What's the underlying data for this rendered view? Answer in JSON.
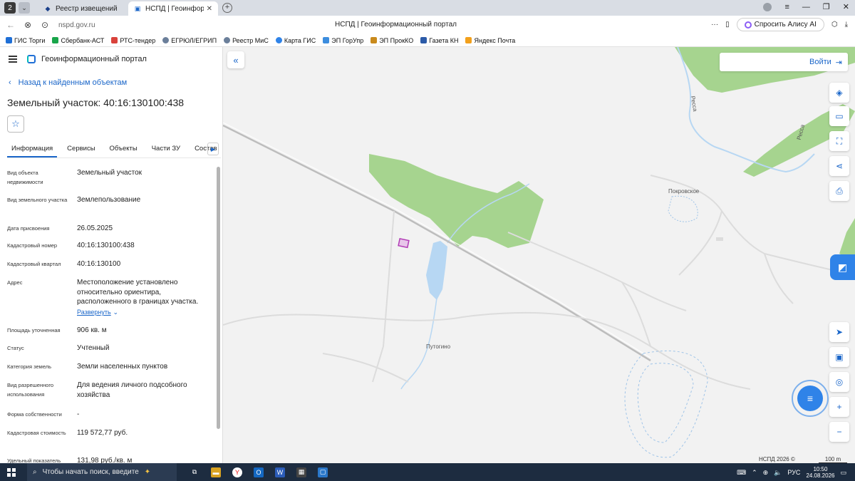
{
  "browser": {
    "tab_count": "2",
    "tabs": [
      {
        "title": "Реестр извещений",
        "active": false
      },
      {
        "title": "НСПД | Геоинформаци",
        "active": true
      }
    ],
    "url": "nspd.gov.ru",
    "page_title": "НСПД | Геоинформационный портал",
    "alisa": "Спросить Алису AI",
    "bookmarks": [
      "ГИС Торги",
      "Сбербанк-АСТ",
      "РТС-тендер",
      "ЕГРЮЛ/ЕГРИП",
      "Реестр МиС",
      "Карта ГИС",
      "ЭП ГорУпр",
      "ЭП ПрокКО",
      "Газета КН",
      "Яндекс Почта"
    ]
  },
  "panel": {
    "app_title": "Геоинформационный портал",
    "back_label": "Назад к найденным объектам",
    "object_title": "Земельный участок: 40:16:130100:438",
    "tabs": [
      "Информация",
      "Сервисы",
      "Объекты",
      "Части ЗУ",
      "Состав"
    ],
    "attributes": [
      {
        "key": "Вид объекта недвижимости",
        "value": "Земельный участок"
      },
      {
        "key": "Вид земельного участка",
        "value": "Землепользование"
      },
      {
        "key": "Дата присвоения",
        "value": "26.05.2025"
      },
      {
        "key": "Кадастровый номер",
        "value": "40:16:130100:438"
      },
      {
        "key": "Кадастровый квартал",
        "value": "40:16:130100"
      },
      {
        "key": "Адрес",
        "value": "Местоположение установлено относительно ориентира, расположенного в границах участка."
      },
      {
        "key": "Площадь уточненная",
        "value": "906 кв. м"
      },
      {
        "key": "Статус",
        "value": "Учтенный"
      },
      {
        "key": "Категория земель",
        "value": "Земли населенных пунктов"
      },
      {
        "key": "Вид разрешенного использования",
        "value": "Для ведения личного подсобного хозяйства"
      },
      {
        "key": "Форма собственности",
        "value": "-"
      },
      {
        "key": "Кадастровая стоимость",
        "value": "119 572,77 руб."
      },
      {
        "key": "Удельный показатель",
        "value": "131,98 руб./кв. м"
      }
    ],
    "expand_label": "Развернуть"
  },
  "map": {
    "login": "Войти",
    "labels": [
      "Покровское",
      "Путогино",
      "Ресса",
      "Ресса"
    ],
    "copyright": "НСПД 2026 ©",
    "scale": "100 m",
    "colors": {
      "forest": "#a6d48f",
      "water": "#b7d7f3",
      "parcel": "#b13bb5",
      "accent": "#1a66c9"
    }
  },
  "taskbar": {
    "search_placeholder": "Чтобы начать поиск, введите",
    "lang": "РУС",
    "time": "10:50",
    "date": "24.08.2026"
  }
}
